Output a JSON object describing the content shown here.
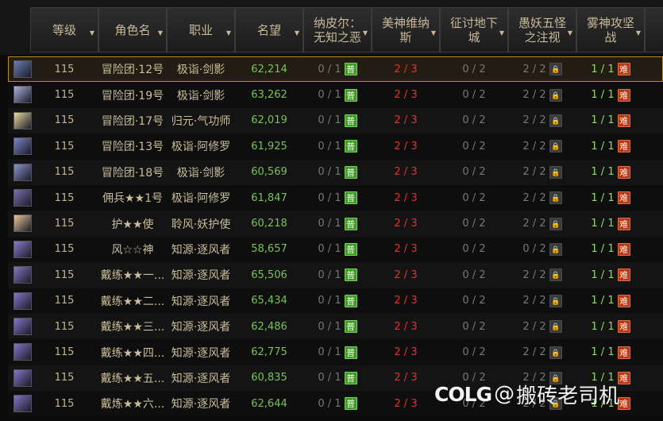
{
  "headers": {
    "level": "等级",
    "name": "角色名",
    "class": "职业",
    "fame": "名望",
    "d1": [
      "纳皮尔：",
      "无知之恶"
    ],
    "d2": [
      "美神维纳",
      "斯"
    ],
    "d3": [
      "征讨地下",
      "城"
    ],
    "d4": [
      "愚妖五怪",
      "之注视"
    ],
    "d5": [
      "雾神攻坚",
      "战"
    ]
  },
  "colors": {
    "header_text": "#c8b89a",
    "fame_green": "#79c25a",
    "red": "#e2332e",
    "green": "#8ae062",
    "gray": "#777777",
    "selected_border": "#b68a33"
  },
  "badges": {
    "pu": "普",
    "nan": "难",
    "lock": "lock-icon"
  },
  "rows": [
    {
      "level": "115",
      "name": "冒险团·12号",
      "class": "极诣·剑影",
      "fame": "62,214",
      "d1": "0 / 1",
      "d2": "2 / 3",
      "d3": "0 / 2",
      "d4": "2 / 2",
      "d5": "1 / 1",
      "avatar": "#6b7fb0"
    },
    {
      "level": "115",
      "name": "冒险团·19号",
      "class": "极诣·剑影",
      "fame": "63,262",
      "d1": "0 / 1",
      "d2": "2 / 3",
      "d3": "0 / 2",
      "d4": "2 / 2",
      "d5": "1 / 1",
      "avatar": "#aab4d8"
    },
    {
      "level": "115",
      "name": "冒险团·17号",
      "class": "归元·气功师",
      "fame": "62,019",
      "d1": "0 / 1",
      "d2": "2 / 3",
      "d3": "0 / 2",
      "d4": "2 / 2",
      "d5": "1 / 1",
      "avatar": "#e8d9a0"
    },
    {
      "level": "115",
      "name": "冒险团·13号",
      "class": "极诣·阿修罗",
      "fame": "61,925",
      "d1": "0 / 1",
      "d2": "2 / 3",
      "d3": "0 / 2",
      "d4": "2 / 2",
      "d5": "1 / 1",
      "avatar": "#7b86c4"
    },
    {
      "level": "115",
      "name": "冒险团·18号",
      "class": "极诣·剑影",
      "fame": "60,569",
      "d1": "0 / 1",
      "d2": "2 / 3",
      "d3": "0 / 2",
      "d4": "2 / 2",
      "d5": "1 / 1",
      "avatar": "#8a94c8"
    },
    {
      "level": "115",
      "name": "佣兵★★1号",
      "class": "极诣·阿修罗",
      "fame": "61,847",
      "d1": "0 / 1",
      "d2": "2 / 3",
      "d3": "0 / 2",
      "d4": "2 / 2",
      "d5": "1 / 1",
      "avatar": "#7c6fa8"
    },
    {
      "level": "115",
      "name": "护★★使",
      "class": "聆风·妖护使",
      "fame": "60,218",
      "d1": "0 / 1",
      "d2": "2 / 3",
      "d3": "0 / 2",
      "d4": "2 / 2",
      "d5": "1 / 1",
      "avatar": "#e8c89a"
    },
    {
      "level": "115",
      "name": "风☆☆神",
      "class": "知源·逐风者",
      "fame": "58,657",
      "d1": "0 / 1",
      "d2": "2 / 3",
      "d3": "0 / 2",
      "d4": "0 / 2",
      "d5": "1 / 1",
      "avatar": "#8a7cc8"
    },
    {
      "level": "115",
      "name": "戴练★★一...",
      "class": "知源·逐风者",
      "fame": "65,506",
      "d1": "0 / 1",
      "d2": "2 / 3",
      "d3": "0 / 2",
      "d4": "2 / 2",
      "d5": "1 / 1",
      "avatar": "#8576c2"
    },
    {
      "level": "115",
      "name": "戴练★★二...",
      "class": "知源·逐风者",
      "fame": "65,434",
      "d1": "0 / 1",
      "d2": "2 / 3",
      "d3": "0 / 2",
      "d4": "2 / 2",
      "d5": "1 / 1",
      "avatar": "#8576c2"
    },
    {
      "level": "115",
      "name": "戴练★★三...",
      "class": "知源·逐风者",
      "fame": "62,486",
      "d1": "0 / 1",
      "d2": "2 / 3",
      "d3": "0 / 2",
      "d4": "2 / 2",
      "d5": "1 / 1",
      "avatar": "#8576c2"
    },
    {
      "level": "115",
      "name": "戴练★★四...",
      "class": "知源·逐风者",
      "fame": "62,775",
      "d1": "0 / 1",
      "d2": "2 / 3",
      "d3": "0 / 2",
      "d4": "2 / 2",
      "d5": "1 / 1",
      "avatar": "#8576c2"
    },
    {
      "level": "115",
      "name": "戴练★★五...",
      "class": "知源·逐风者",
      "fame": "60,835",
      "d1": "0 / 1",
      "d2": "2 / 3",
      "d3": "0 / 2",
      "d4": "2 / 2",
      "d5": "1 / 1",
      "avatar": "#8576c2"
    },
    {
      "level": "115",
      "name": "戴炼★★六...",
      "class": "知源·逐风者",
      "fame": "62,644",
      "d1": "0 / 1",
      "d2": "2 / 3",
      "d3": "0 / 2",
      "d4": "2 / 2",
      "d5": "1 / 1",
      "avatar": "#8576c2"
    }
  ],
  "watermark": {
    "logo": "COLG",
    "at": "@",
    "text": "搬砖老司机"
  }
}
